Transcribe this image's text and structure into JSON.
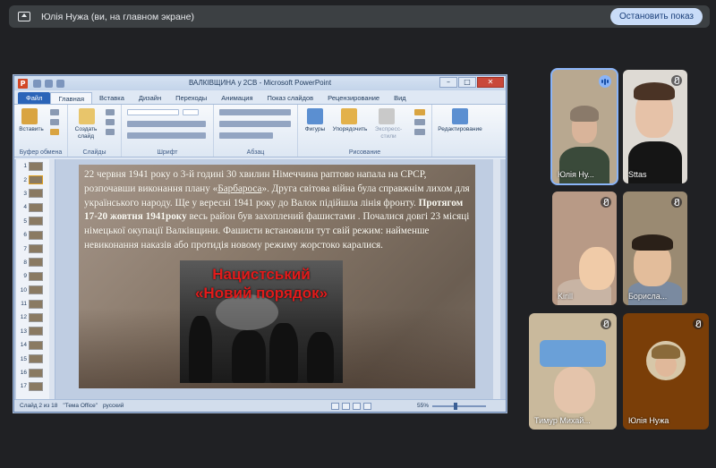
{
  "banner": {
    "title": "Юлія Нужа (ви, на главном экране)",
    "stop_label": "Остановить показ"
  },
  "ppt": {
    "window_title": "ВАЛКІВЩИНА у 2СВ  -  Microsoft PowerPoint",
    "tabs": [
      "Файл",
      "Главная",
      "Вставка",
      "Дизайн",
      "Переходы",
      "Анимация",
      "Показ слайдов",
      "Рецензирование",
      "Вид"
    ],
    "groups": {
      "clipboard": "Буфер обмена",
      "slides": "Слайды",
      "font": "Шрифт",
      "paragraph": "Абзац",
      "drawing": "Рисование"
    },
    "buttons": {
      "paste": "Вставить",
      "create_slide": "Создать слайд",
      "shapes": "Фигуры",
      "arrange": "Упорядочить",
      "quick_styles": "Экспресс-стили",
      "editing": "Редактирование"
    },
    "slide_numbers": [
      "1",
      "2",
      "3",
      "4",
      "5",
      "6",
      "7",
      "8",
      "9",
      "10",
      "11",
      "12",
      "13",
      "14",
      "15",
      "16",
      "17"
    ],
    "selected_slide": 2,
    "slide": {
      "text_part1": "22 червня 1941 року о 3-й годині 30 хвилин Німеччина раптово напала на СРСР, розпочавши виконання плану «",
      "link_text": "Барбароса",
      "text_part2": "». Друга світова війна була справжнім лихом для українського народу. Ще у вересні 1941 року до Валок підійшла лінія фронту.  ",
      "bold_text": "Протягом 17-20 жовтня 1941року",
      "text_part3": " весь район був захоплений фашистами . Почалися довгі 23 місяці німецької окупації Валківщини. Фашисти встановили тут свій режим: найменше невиконання наказів або протидія новому режиму жорстоко каралися.",
      "heading_line1": "Нацистський",
      "heading_line2": "«Новий порядок»"
    },
    "status": {
      "slide_counter": "Слайд 2 из 18",
      "theme": "\"Тема Office\"",
      "language": "русский",
      "zoom": "55%"
    }
  },
  "participants": [
    {
      "name": "Юлія Ну...",
      "speaking": true
    },
    {
      "name": "Sttas",
      "muted": true
    },
    {
      "name": "Kirill",
      "muted": true
    },
    {
      "name": "Борисла...",
      "muted": true
    },
    {
      "name": "Тимур Михай...",
      "muted": true
    },
    {
      "name": "Юлія Нужа",
      "muted": true
    }
  ],
  "colors": {
    "meet_bg": "#202124",
    "banner_bg": "#3c4043",
    "stop_button_bg": "#c9dcf8",
    "ppt_file_tab": "#2b64b8",
    "slide_heading": "#e21b1b",
    "speaking_indicator": "#8ab4f8"
  }
}
